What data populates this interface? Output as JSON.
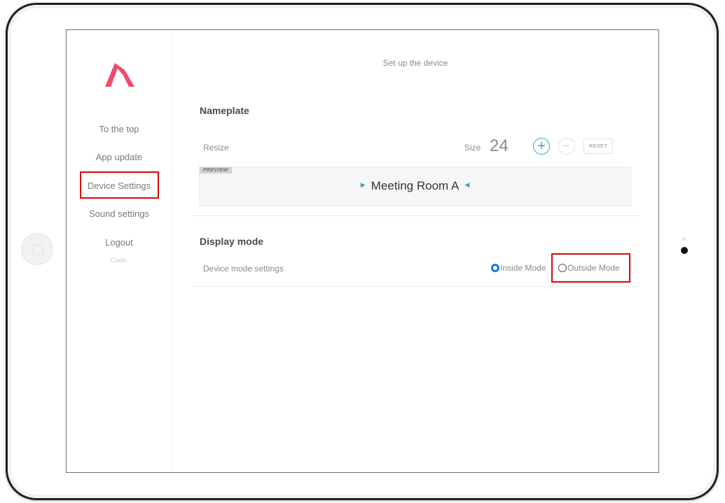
{
  "sidebar": {
    "items": [
      {
        "label": "To the top"
      },
      {
        "label": "App update"
      },
      {
        "label": "Device Settings"
      },
      {
        "label": "Sound settings"
      },
      {
        "label": "Logout"
      }
    ],
    "code_label": "Code:"
  },
  "main": {
    "title": "Set up the device",
    "nameplate": {
      "heading": "Nameplate",
      "resize_label": "Resize",
      "size_label": "Size",
      "size_value": "24",
      "plus_symbol": "+",
      "minus_symbol": "−",
      "reset_label": "RESET",
      "preview_tag": "PREVIEW",
      "preview_text": "Meeting Room A"
    },
    "display_mode": {
      "heading": "Display mode",
      "row_label": "Device mode settings",
      "options": [
        {
          "label": "Inside Mode",
          "selected": true
        },
        {
          "label": "Outside Mode",
          "selected": false
        }
      ]
    }
  },
  "colors": {
    "brand": "#f04a6e",
    "accent": "#3aa3c2",
    "radio_selected": "#1a73e8",
    "highlight": "#d20a0a"
  }
}
